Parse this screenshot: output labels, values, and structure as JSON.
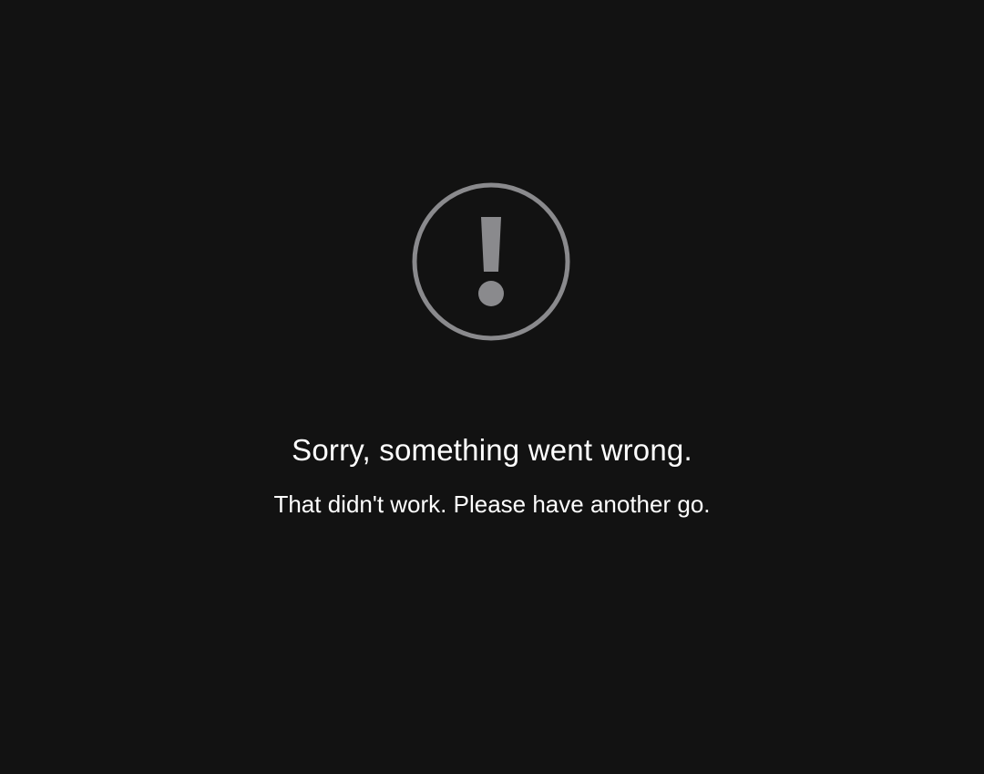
{
  "error": {
    "icon": "exclamation-circle-icon",
    "icon_color": "#8a8a8d",
    "title": "Sorry, something went wrong.",
    "message": "That didn't work. Please have another go."
  },
  "colors": {
    "background": "#121212",
    "text": "#ffffff"
  }
}
